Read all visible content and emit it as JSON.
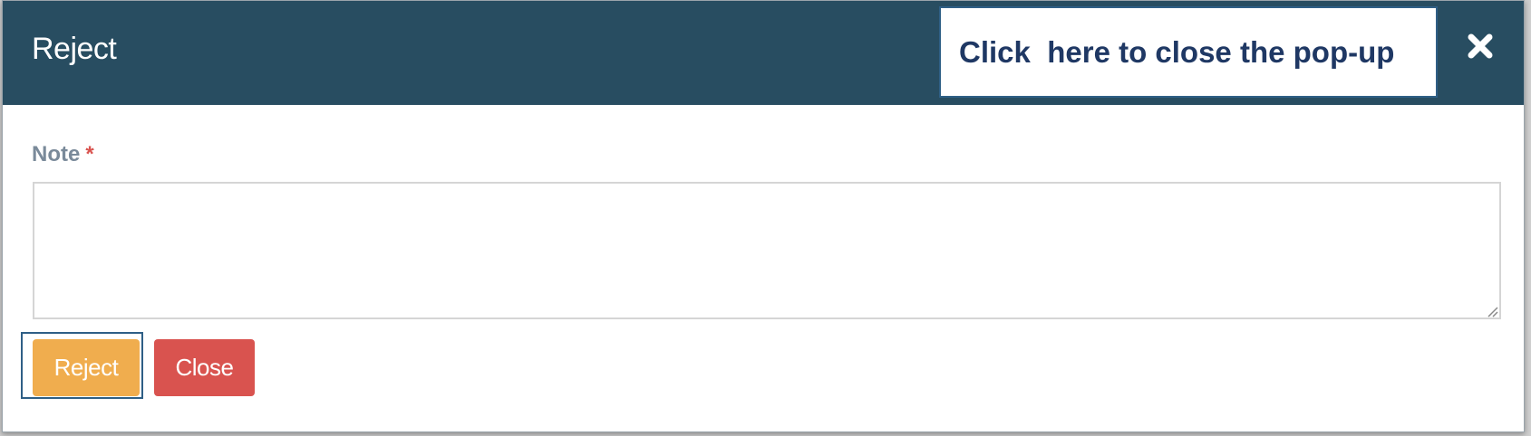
{
  "modal": {
    "title": "Reject",
    "close_icon": "close-icon"
  },
  "callout": {
    "text": "Click  here to close the pop-up"
  },
  "form": {
    "note_label": "Note",
    "required_marker": "*",
    "note_value": ""
  },
  "actions": {
    "reject_label": "Reject",
    "close_label": "Close"
  },
  "colors": {
    "header_bg": "#284d61",
    "reject_button": "#f0ad4e",
    "close_button": "#d9534f",
    "callout_text": "#1f3864"
  }
}
